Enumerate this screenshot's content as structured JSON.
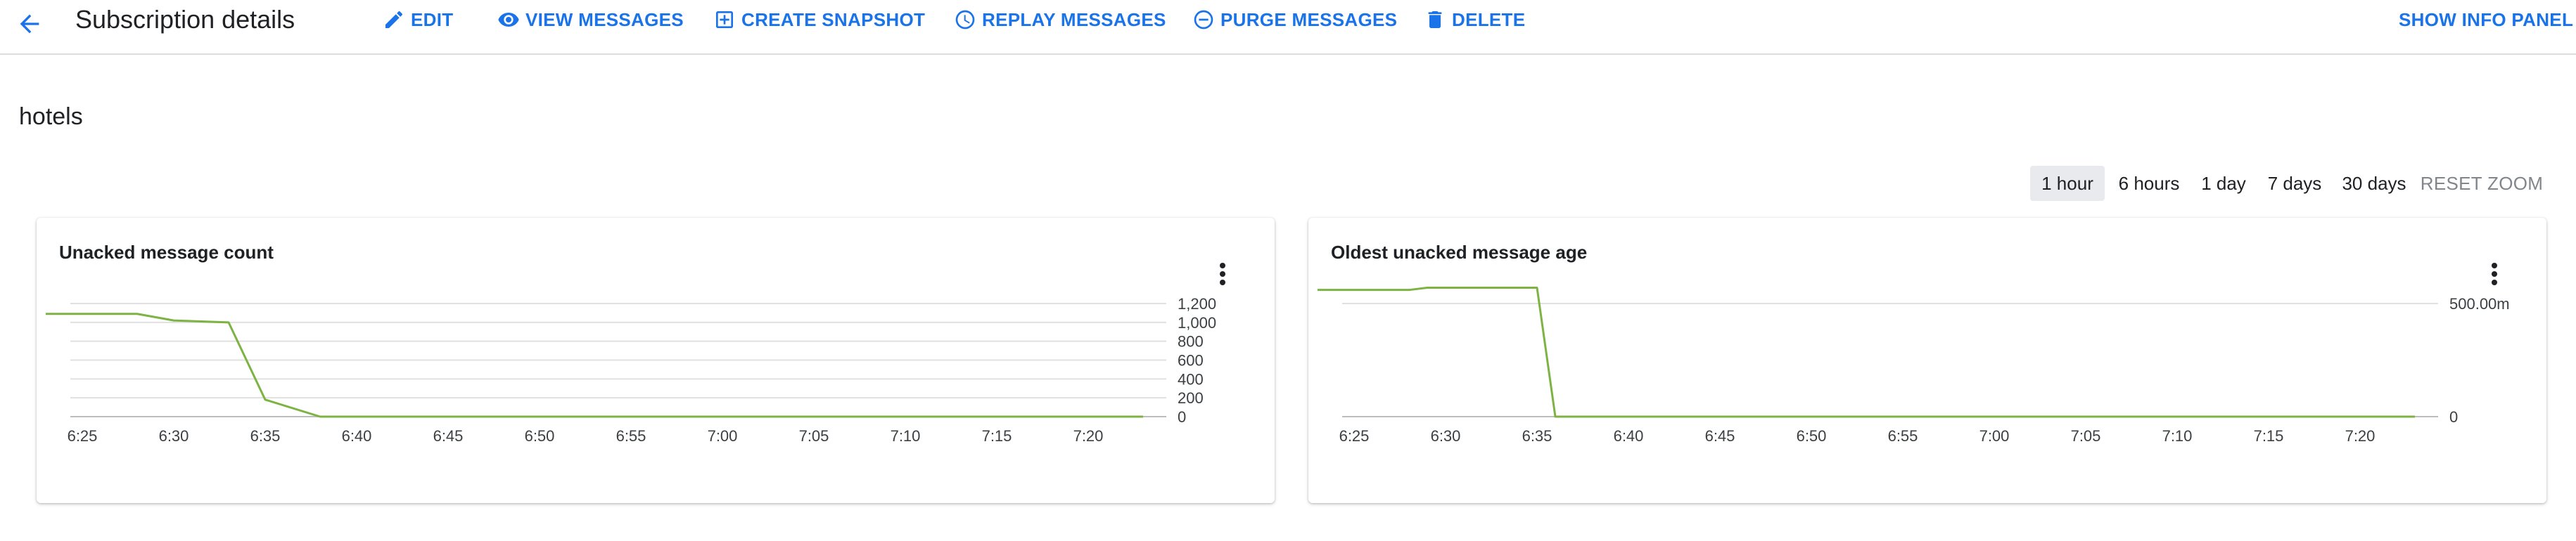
{
  "header": {
    "title": "Subscription details",
    "actions": [
      {
        "label": "EDIT",
        "icon": "pencil-icon"
      },
      {
        "label": "VIEW MESSAGES",
        "icon": "eye-icon"
      },
      {
        "label": "CREATE SNAPSHOT",
        "icon": "add-box-icon"
      },
      {
        "label": "REPLAY MESSAGES",
        "icon": "clock-icon"
      },
      {
        "label": "PURGE MESSAGES",
        "icon": "minus-circle-icon"
      },
      {
        "label": "DELETE",
        "icon": "trash-icon"
      }
    ],
    "info_panel_label": "SHOW INFO PANEL"
  },
  "subscription": {
    "name": "hotels"
  },
  "time_ranges": {
    "options": [
      "1 hour",
      "6 hours",
      "1 day",
      "7 days",
      "30 days"
    ],
    "selected": "1 hour",
    "reset_label": "RESET ZOOM"
  },
  "colors": {
    "accent": "#1a73e8",
    "line": "#7cb342",
    "grid": "#e0e0e0"
  },
  "chart_data": [
    {
      "type": "line",
      "title": "Unacked message count",
      "x": [
        "6:23",
        "6:28",
        "6:30",
        "6:33",
        "6:35",
        "6:38",
        "7:23"
      ],
      "series": [
        {
          "values": [
            1090,
            1090,
            1020,
            1000,
            180,
            0,
            0
          ]
        }
      ],
      "xticks": [
        "6:25",
        "6:30",
        "6:35",
        "6:40",
        "6:45",
        "6:50",
        "6:55",
        "7:00",
        "7:05",
        "7:10",
        "7:15",
        "7:20"
      ],
      "yticks": [
        "0",
        "200",
        "400",
        "600",
        "800",
        "1,000",
        "1,200"
      ],
      "ylim": [
        0,
        1200
      ],
      "grid": true,
      "legend": "none"
    },
    {
      "type": "line",
      "title": "Oldest unacked message age",
      "x": [
        "6:23",
        "6:28",
        "6:29",
        "6:35",
        "6:36",
        "7:23"
      ],
      "series": [
        {
          "values": [
            0.56,
            0.56,
            0.57,
            0.57,
            0,
            0
          ]
        }
      ],
      "xticks": [
        "6:25",
        "6:30",
        "6:35",
        "6:40",
        "6:45",
        "6:50",
        "6:55",
        "7:00",
        "7:05",
        "7:10",
        "7:15",
        "7:20"
      ],
      "yticks": [
        "0",
        "500.00m"
      ],
      "ylim": [
        0,
        0.6
      ],
      "grid": true,
      "legend": "none"
    }
  ]
}
